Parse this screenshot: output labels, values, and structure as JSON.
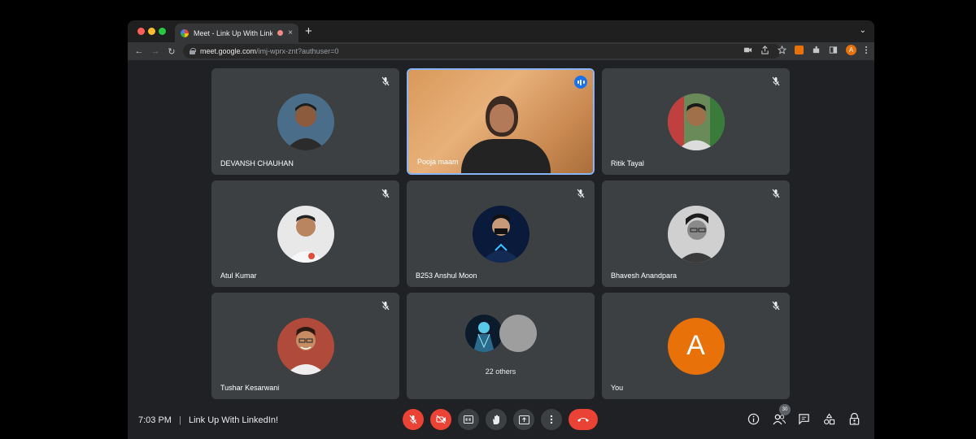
{
  "browser": {
    "tab_title": "Meet - Link Up With Linked",
    "tab_close": "×",
    "new_tab": "+",
    "tab_menu": "⌄",
    "url_host": "meet.google.com",
    "url_path": "/imj-wprx-znt?authuser=0",
    "profile_initial": "A"
  },
  "participants": [
    {
      "name": "DEVANSH CHAUHAN",
      "muted": true
    },
    {
      "name": "Pooja maam",
      "muted": false,
      "speaking": true
    },
    {
      "name": "Ritik Tayal",
      "muted": true
    },
    {
      "name": "Atul Kumar",
      "muted": true
    },
    {
      "name": "B253 Anshul Moon",
      "muted": true
    },
    {
      "name": "Bhavesh Anandpara",
      "muted": true
    },
    {
      "name": "Tushar Kesarwani",
      "muted": true
    },
    {
      "others_label": "22 others"
    },
    {
      "name": "You",
      "initial": "A",
      "muted": true
    }
  ],
  "footer": {
    "time": "7:03 PM",
    "separator": "|",
    "meeting_title": "Link Up With LinkedIn!",
    "people_count": "30"
  },
  "colors": {
    "accent_blue": "#1a73e8",
    "danger_red": "#ea4335",
    "you_avatar": "#e8710a",
    "tile_bg": "#3c4043"
  }
}
